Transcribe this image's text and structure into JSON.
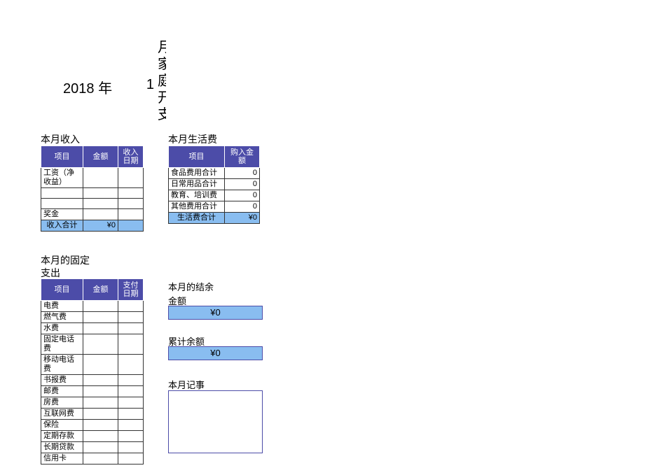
{
  "title": {
    "year": "2018",
    "year_suffix": "年",
    "month": "1",
    "cutoff": "月家庭开支"
  },
  "income": {
    "label": "本月收入",
    "headers": {
      "item": "项目",
      "amount": "金额",
      "date": "收入日期"
    },
    "rows": [
      {
        "item": "工资（净收益）",
        "amount": "",
        "date": ""
      },
      {
        "item": "",
        "amount": "",
        "date": ""
      },
      {
        "item": "",
        "amount": "",
        "date": ""
      },
      {
        "item": "奖金",
        "amount": "",
        "date": ""
      }
    ],
    "total_label": "收入合计",
    "total_value": "¥0"
  },
  "living": {
    "label": "本月生活费",
    "headers": {
      "item": "项目",
      "amount": "购入金额"
    },
    "rows": [
      {
        "item": "食品费用合计",
        "amount": "0"
      },
      {
        "item": "日常用品合计",
        "amount": "0"
      },
      {
        "item": "教育、培训费",
        "amount": "0"
      },
      {
        "item": "其他费用合计",
        "amount": "0"
      }
    ],
    "total_label": "生活费合计",
    "total_value": "¥0"
  },
  "fixed": {
    "label_line1": "本月的固定",
    "label_line2": "支出",
    "headers": {
      "item": "项目",
      "amount": "金额",
      "date": "支付日期"
    },
    "rows": [
      {
        "item": "电费",
        "amount": "",
        "date": ""
      },
      {
        "item": "燃气费",
        "amount": "",
        "date": ""
      },
      {
        "item": "水费",
        "amount": "",
        "date": ""
      },
      {
        "item": "固定电话费",
        "amount": "",
        "date": ""
      },
      {
        "item": "移动电话费",
        "amount": "",
        "date": ""
      },
      {
        "item": "书报费",
        "amount": "",
        "date": ""
      },
      {
        "item": "邮费",
        "amount": "",
        "date": ""
      },
      {
        "item": "房费",
        "amount": "",
        "date": ""
      },
      {
        "item": "互联网费",
        "amount": "",
        "date": ""
      },
      {
        "item": "保险",
        "amount": "",
        "date": ""
      },
      {
        "item": "定期存款",
        "amount": "",
        "date": ""
      },
      {
        "item": "长期贷款",
        "amount": "",
        "date": ""
      },
      {
        "item": "信用卡",
        "amount": "",
        "date": ""
      }
    ]
  },
  "balance": {
    "title": "本月的结余",
    "amount_label": "金额",
    "amount_value": "¥0",
    "cumulative_label": "累计余额",
    "cumulative_value": "¥0"
  },
  "memo": {
    "label": "本月记事",
    "text": ""
  }
}
